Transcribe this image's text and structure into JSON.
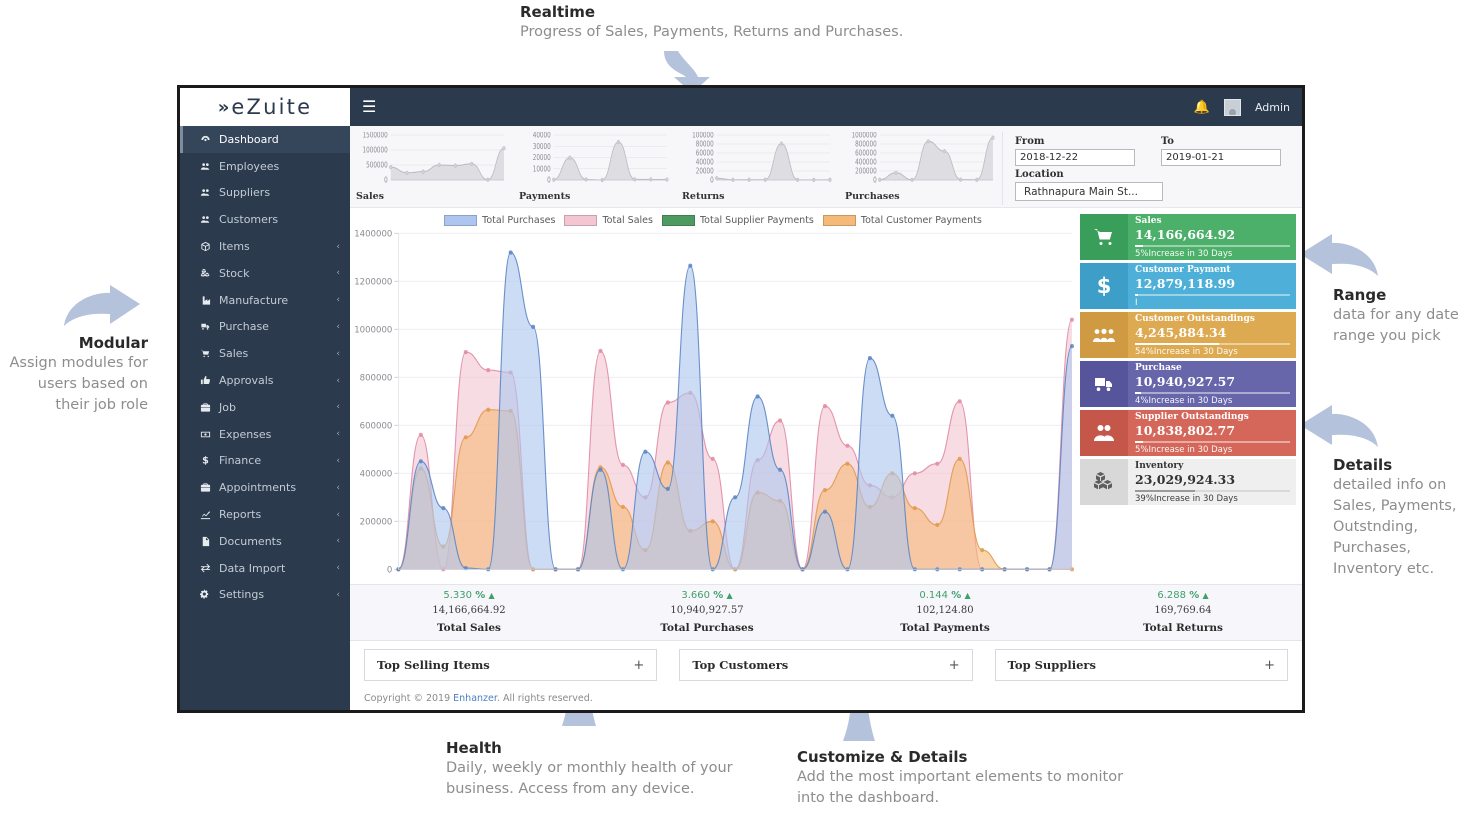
{
  "annotations": [
    {
      "key": "realtime",
      "title": "Realtime",
      "body": "Progress of Sales, Payments, Returns and Purchases."
    },
    {
      "key": "modular",
      "title": "Modular",
      "body": "Assign modules for users based on their  job role"
    },
    {
      "key": "range",
      "title": "Range",
      "body": "data for any date range you pick"
    },
    {
      "key": "details",
      "title": "Details",
      "body": "detailed info on Sales, Payments, Outstnding, Purchases, Inventory etc."
    },
    {
      "key": "health",
      "title": "Health",
      "body": "Daily, weekly or monthly health of your business. Access from any device."
    },
    {
      "key": "customize",
      "title": "Customize & Details",
      "body": "Add the most important elements to monitor into the dashboard."
    }
  ],
  "brand": {
    "mark": "»",
    "name": "eZuite"
  },
  "topbar": {
    "menu_icon": "hamburger-icon",
    "notification_icon": "bell-icon",
    "user_label": "Admin"
  },
  "sidebar": {
    "items": [
      {
        "label": "Dashboard",
        "icon": "dashboard-icon",
        "caret": false,
        "active": true
      },
      {
        "label": "Employees",
        "icon": "users-icon",
        "caret": false,
        "active": false
      },
      {
        "label": "Suppliers",
        "icon": "users-icon",
        "caret": false,
        "active": false
      },
      {
        "label": "Customers",
        "icon": "users-icon",
        "caret": false,
        "active": false
      },
      {
        "label": "Items",
        "icon": "box-icon",
        "caret": true,
        "active": false
      },
      {
        "label": "Stock",
        "icon": "cubes-icon",
        "caret": true,
        "active": false
      },
      {
        "label": "Manufacture",
        "icon": "factory-icon",
        "caret": true,
        "active": false
      },
      {
        "label": "Purchase",
        "icon": "truck-icon",
        "caret": true,
        "active": false
      },
      {
        "label": "Sales",
        "icon": "cart-icon",
        "caret": true,
        "active": false
      },
      {
        "label": "Approvals",
        "icon": "thumbs-up-icon",
        "caret": true,
        "active": false
      },
      {
        "label": "Job",
        "icon": "briefcase-icon",
        "caret": true,
        "active": false
      },
      {
        "label": "Expenses",
        "icon": "money-icon",
        "caret": true,
        "active": false
      },
      {
        "label": "Finance",
        "icon": "dollar-icon",
        "caret": true,
        "active": false
      },
      {
        "label": "Appointments",
        "icon": "briefcase-icon",
        "caret": true,
        "active": false
      },
      {
        "label": "Reports",
        "icon": "chart-line-icon",
        "caret": true,
        "active": false
      },
      {
        "label": "Documents",
        "icon": "document-icon",
        "caret": true,
        "active": false
      },
      {
        "label": "Data Import",
        "icon": "exchange-icon",
        "caret": true,
        "active": false
      },
      {
        "label": "Settings",
        "icon": "gears-icon",
        "caret": true,
        "active": false
      }
    ],
    "caret_glyph": "‹"
  },
  "filters": {
    "from_label": "From",
    "from_value": "2018-12-22",
    "to_label": "To",
    "to_value": "2019-01-21",
    "location_label": "Location",
    "location_value": "Rathnapura Main St..."
  },
  "sparklines": [
    {
      "title": "Sales",
      "yticks": [
        "1500000",
        "1000000",
        "500000",
        "0"
      ],
      "values": [
        430000,
        240000,
        280000,
        500000,
        480000,
        540000,
        10000,
        1060000
      ],
      "max": 1500000
    },
    {
      "title": "Payments",
      "yticks": [
        "40000",
        "30000",
        "20000",
        "10000",
        "0"
      ],
      "values": [
        300,
        19800,
        500,
        -900,
        33800,
        600,
        500,
        400
      ],
      "max": 40000
    },
    {
      "title": "Returns",
      "yticks": [
        "100000",
        "80000",
        "60000",
        "40000",
        "20000",
        "0"
      ],
      "values": [
        4000,
        400,
        500,
        600,
        81000,
        400,
        300,
        500
      ],
      "max": 100000
    },
    {
      "title": "Purchases",
      "yticks": [
        "1000000",
        "800000",
        "600000",
        "400000",
        "200000",
        "0"
      ],
      "values": [
        6000,
        160000,
        4000,
        860000,
        640000,
        8000,
        6000,
        940000
      ],
      "max": 1000000
    }
  ],
  "chart_data": {
    "type": "area",
    "title": "",
    "xlabel": "",
    "ylabel": "",
    "ylim": [
      0,
      1400000
    ],
    "yticks": [
      0,
      200000,
      400000,
      600000,
      800000,
      1000000,
      1200000,
      1400000
    ],
    "ytick_labels": [
      "0",
      "200000",
      "400000",
      "600000",
      "800000",
      "1000000",
      "1200000",
      "1400000"
    ],
    "grid": true,
    "legend_position": "top-center",
    "x": [
      1,
      2,
      3,
      4,
      5,
      6,
      7,
      8,
      9,
      10,
      11,
      12,
      13,
      14,
      15,
      16,
      17,
      18,
      19,
      20,
      21,
      22,
      23,
      24,
      25,
      26,
      27,
      28,
      29,
      30,
      31
    ],
    "series": [
      {
        "name": "Total Purchases",
        "color": "#aec6ef",
        "line": "#5b86c4",
        "values": [
          0,
          450000,
          255000,
          5000,
          0,
          1320000,
          1010000,
          0,
          0,
          415000,
          0,
          490000,
          335000,
          1265000,
          0,
          300000,
          720000,
          415000,
          0,
          240000,
          0,
          880000,
          640000,
          0,
          0,
          0,
          0,
          0,
          0,
          0,
          930000
        ]
      },
      {
        "name": "Total Sales",
        "color": "#f4c6d2",
        "line": "#e28ba6",
        "values": [
          0,
          560000,
          0,
          905000,
          830000,
          820000,
          0,
          0,
          0,
          910000,
          435000,
          300000,
          695000,
          735000,
          460000,
          0,
          455000,
          620000,
          0,
          680000,
          515000,
          350000,
          300000,
          400000,
          440000,
          700000,
          0,
          0,
          0,
          0,
          1040000
        ]
      },
      {
        "name": "Total Supplier Payments",
        "color": "#4e9b62",
        "line": "#3d8a52",
        "values": [
          0,
          0,
          0,
          0,
          0,
          0,
          0,
          0,
          0,
          0,
          0,
          0,
          0,
          0,
          0,
          0,
          0,
          0,
          0,
          0,
          0,
          0,
          0,
          0,
          0,
          0,
          0,
          0,
          0,
          0,
          0
        ]
      },
      {
        "name": "Total Customer Payments",
        "color": "#f5b97a",
        "line": "#e09a4e",
        "values": [
          0,
          420000,
          95000,
          550000,
          665000,
          660000,
          0,
          0,
          0,
          425000,
          260000,
          80000,
          445000,
          160000,
          200000,
          0,
          320000,
          285000,
          0,
          330000,
          440000,
          260000,
          400000,
          255000,
          185000,
          460000,
          80000,
          0,
          0,
          0,
          0
        ]
      }
    ]
  },
  "kpis": [
    {
      "name": "Sales",
      "value": "14,166,664.92",
      "foot": "5%Increase in 30 Days",
      "icon": "cart-icon",
      "fill": "#4cb06a",
      "iconbg": "#3a9e5b",
      "pct": 5,
      "theme": "color"
    },
    {
      "name": "Customer Payment",
      "value": "12,879,118.99",
      "foot": "I",
      "icon": "dollar-icon",
      "fill": "#4eb0d8",
      "iconbg": "#3d9ec8",
      "pct": 2,
      "theme": "color"
    },
    {
      "name": "Customer Outstandings",
      "value": "4,245,884.34",
      "foot": "54%Increase in 30 Days",
      "icon": "group-icon",
      "fill": "#ddaa52",
      "iconbg": "#cf9a41",
      "pct": 54,
      "theme": "color"
    },
    {
      "name": "Purchase",
      "value": "10,940,927.57",
      "foot": "4%Increase in 30 Days",
      "icon": "truck-icon",
      "fill": "#6766ab",
      "iconbg": "#56559c",
      "pct": 4,
      "theme": "color"
    },
    {
      "name": "Supplier Outstandings",
      "value": "10,838,802.77",
      "foot": "5%Increase in 30 Days",
      "icon": "people-icon",
      "fill": "#d4675a",
      "iconbg": "#c4564a",
      "pct": 5,
      "theme": "color"
    },
    {
      "name": "Inventory",
      "value": "23,029,924.33",
      "foot": "39%Increase in 30 Days",
      "icon": "cubes-icon",
      "fill": "#efefef",
      "iconbg": "#d8d8d8",
      "pct": 39,
      "theme": "grey"
    }
  ],
  "stats": [
    {
      "pct": "5.330",
      "unit": "%",
      "value": "14,166,664.92",
      "name": "Total Sales"
    },
    {
      "pct": "3.660",
      "unit": "%",
      "value": "10,940,927.57",
      "name": "Total Purchases"
    },
    {
      "pct": "0.144",
      "unit": "%",
      "value": "102,124.80",
      "name": "Total Payments"
    },
    {
      "pct": "6.288",
      "unit": "%",
      "value": "169,769.64",
      "name": "Total Returns"
    }
  ],
  "panels": [
    {
      "title": "Top Selling Items",
      "plus": "+"
    },
    {
      "title": "Top Customers",
      "plus": "+"
    },
    {
      "title": "Top Suppliers",
      "plus": "+"
    }
  ],
  "footer": {
    "pre": "Copyright © 2019 ",
    "link": "Enhanzer",
    "post": ". All rights reserved."
  },
  "colors": {
    "sidebar": "#2b3a4c",
    "sidebar_active": "#35465b",
    "accent_green": "#4cb06a",
    "accent_blue": "#4eb0d8",
    "arrow": "#b4c2dc",
    "stat_green": "#3fa06a"
  }
}
